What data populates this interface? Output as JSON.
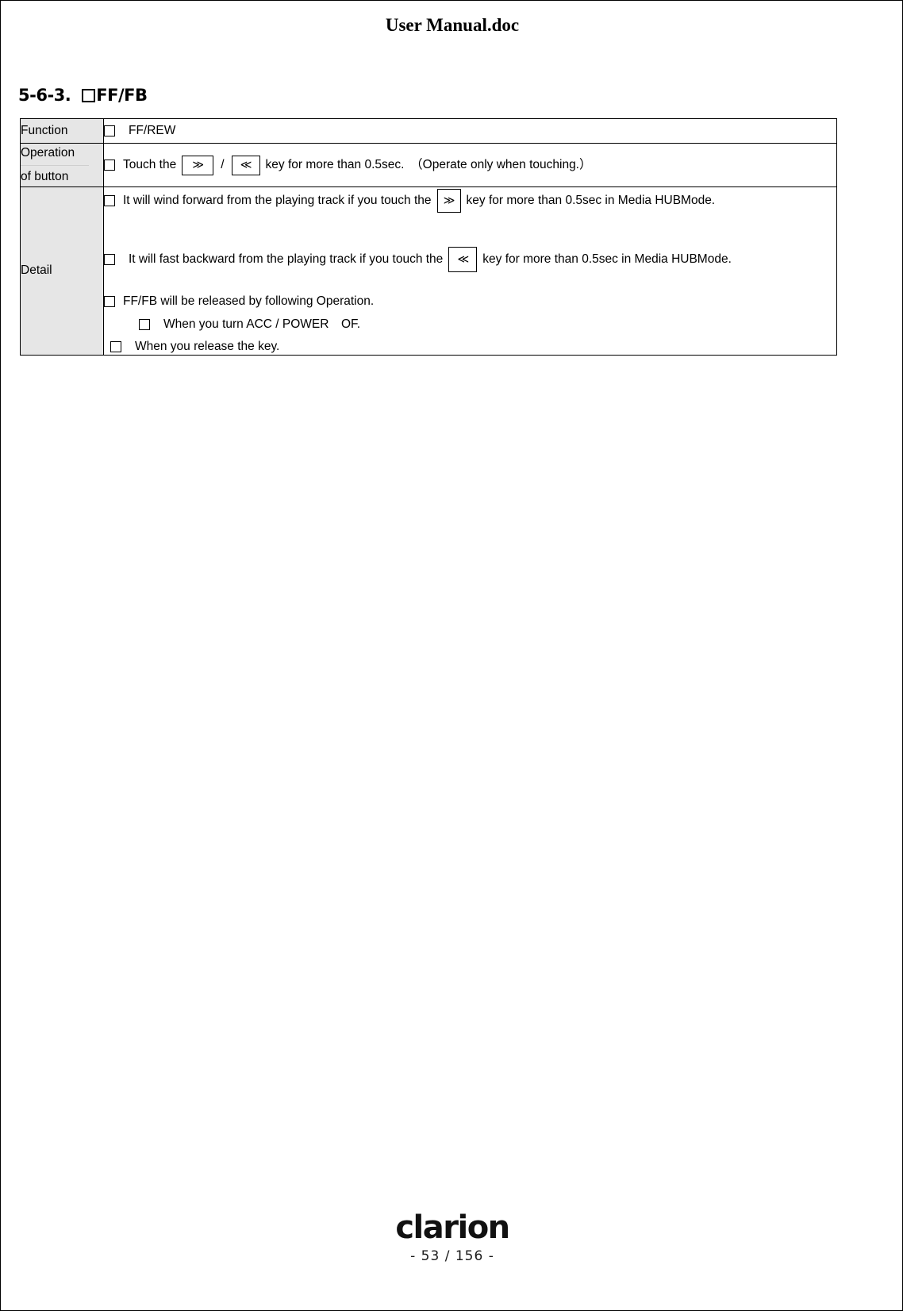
{
  "document": {
    "title": "User Manual.doc"
  },
  "heading": {
    "number": "5-6-3.",
    "box_icon": "empty-checkbox",
    "text": "FF/FB"
  },
  "table": {
    "rows": {
      "function": {
        "label": "Function",
        "checkbox": "empty-checkbox",
        "text": "FF/REW"
      },
      "operation": {
        "label_line1": "Operation",
        "label_line2": "of button",
        "checkbox": "empty-checkbox",
        "text_before_keys": "Touch the",
        "key_forward": "≫",
        "separator": "/",
        "key_backward": "≪",
        "text_after_keys": "key for more than 0.5sec.　（Operate only when touching.）"
      },
      "detail": {
        "label": "Detail",
        "items": [
          {
            "checkbox": "empty-checkbox",
            "text_before_key": "It will wind forward from the playing track if you touch the",
            "key": "≫",
            "text_after_key": "key for more than 0.5sec in Media HUBMode."
          },
          {
            "checkbox": "empty-checkbox",
            "text_before_key": "It will fast backward from the playing track if you touch the",
            "key": "≪",
            "text_after_key": "key for more than 0.5sec in Media HUBMode."
          },
          {
            "checkbox": "empty-checkbox",
            "text": "FF/FB will be released by following Operation."
          },
          {
            "checkbox": "empty-checkbox",
            "text": "When you turn ACC / POWER　OF."
          },
          {
            "checkbox": "empty-checkbox",
            "text": "When you release the key."
          }
        ]
      }
    }
  },
  "footer": {
    "brand": "clarion",
    "page_number": "- 53 / 156 -"
  },
  "colors": {
    "label_cell_background": "#e6e6e6",
    "border": "#000000",
    "text": "#000000"
  }
}
